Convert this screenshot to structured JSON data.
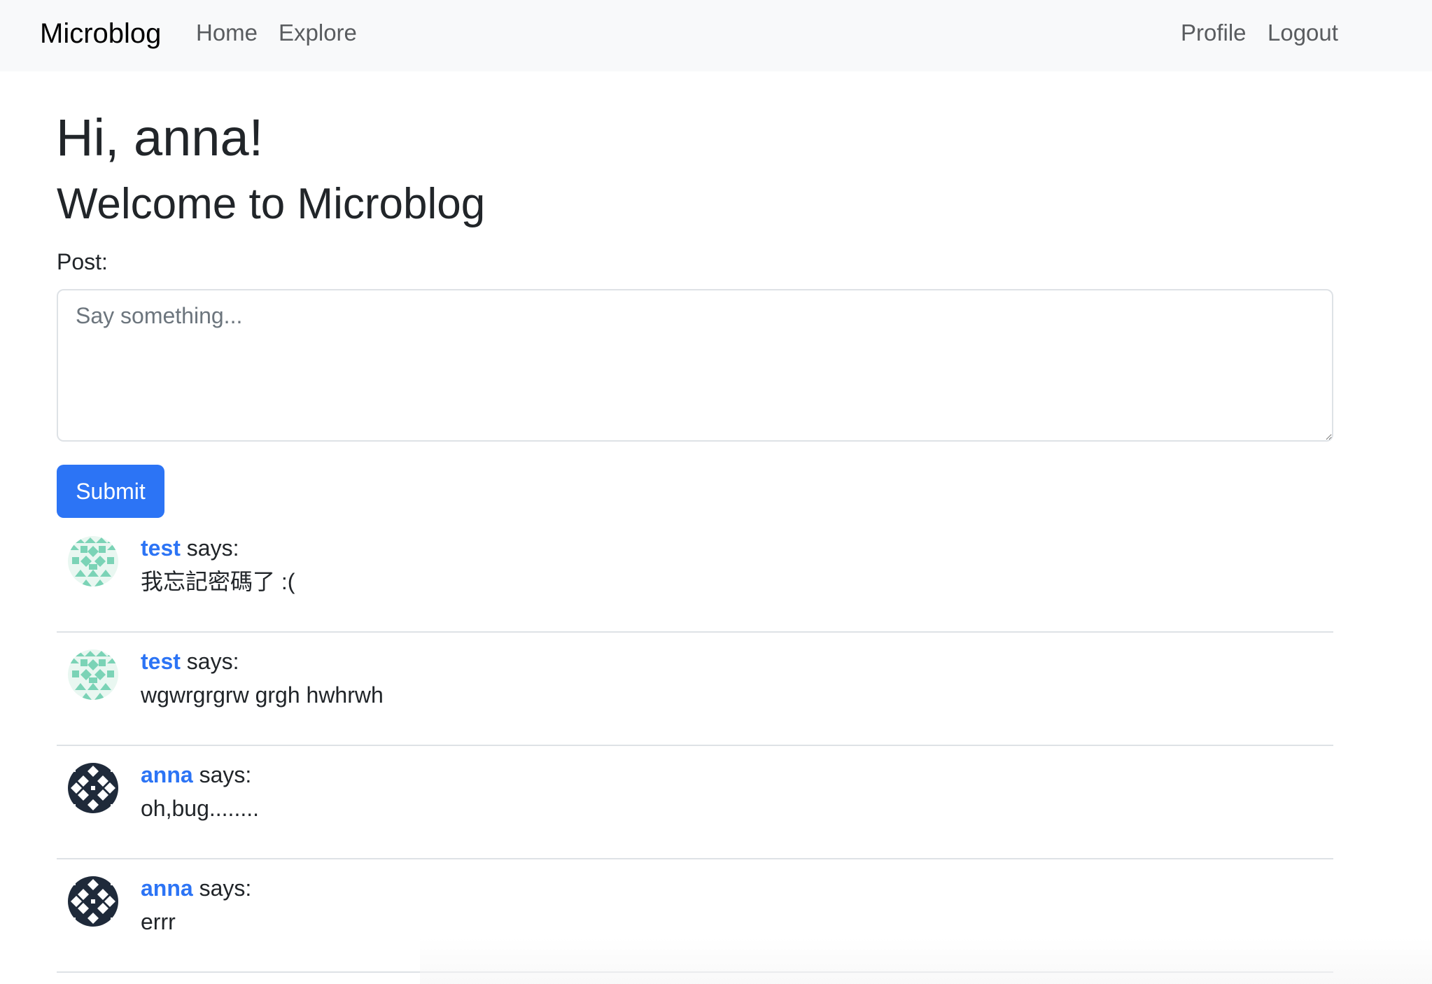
{
  "navbar": {
    "brand": "Microblog",
    "home": "Home",
    "explore": "Explore",
    "profile": "Profile",
    "logout": "Logout"
  },
  "greeting": "Hi, anna!",
  "welcome": "Welcome to Microblog",
  "form": {
    "label": "Post:",
    "placeholder": "Say something...",
    "value": "",
    "submit": "Submit"
  },
  "colors": {
    "accent": "#2c74f5",
    "navbar_bg": "#f8f9fa",
    "avatar_test": "#7bd3b6",
    "avatar_anna": "#1f2a3a"
  },
  "posts": [
    {
      "author": "test",
      "says": "says:",
      "body": "我忘記密碼了 :(",
      "avatar": "identicon-green-icon"
    },
    {
      "author": "test",
      "says": "says:",
      "body": "wgwrgrgrw grgh hwhrwh",
      "avatar": "identicon-green-icon"
    },
    {
      "author": "anna",
      "says": "says:",
      "body": "oh,bug........",
      "avatar": "identicon-dark-icon"
    },
    {
      "author": "anna",
      "says": "says:",
      "body": "errr",
      "avatar": "identicon-dark-icon"
    }
  ]
}
